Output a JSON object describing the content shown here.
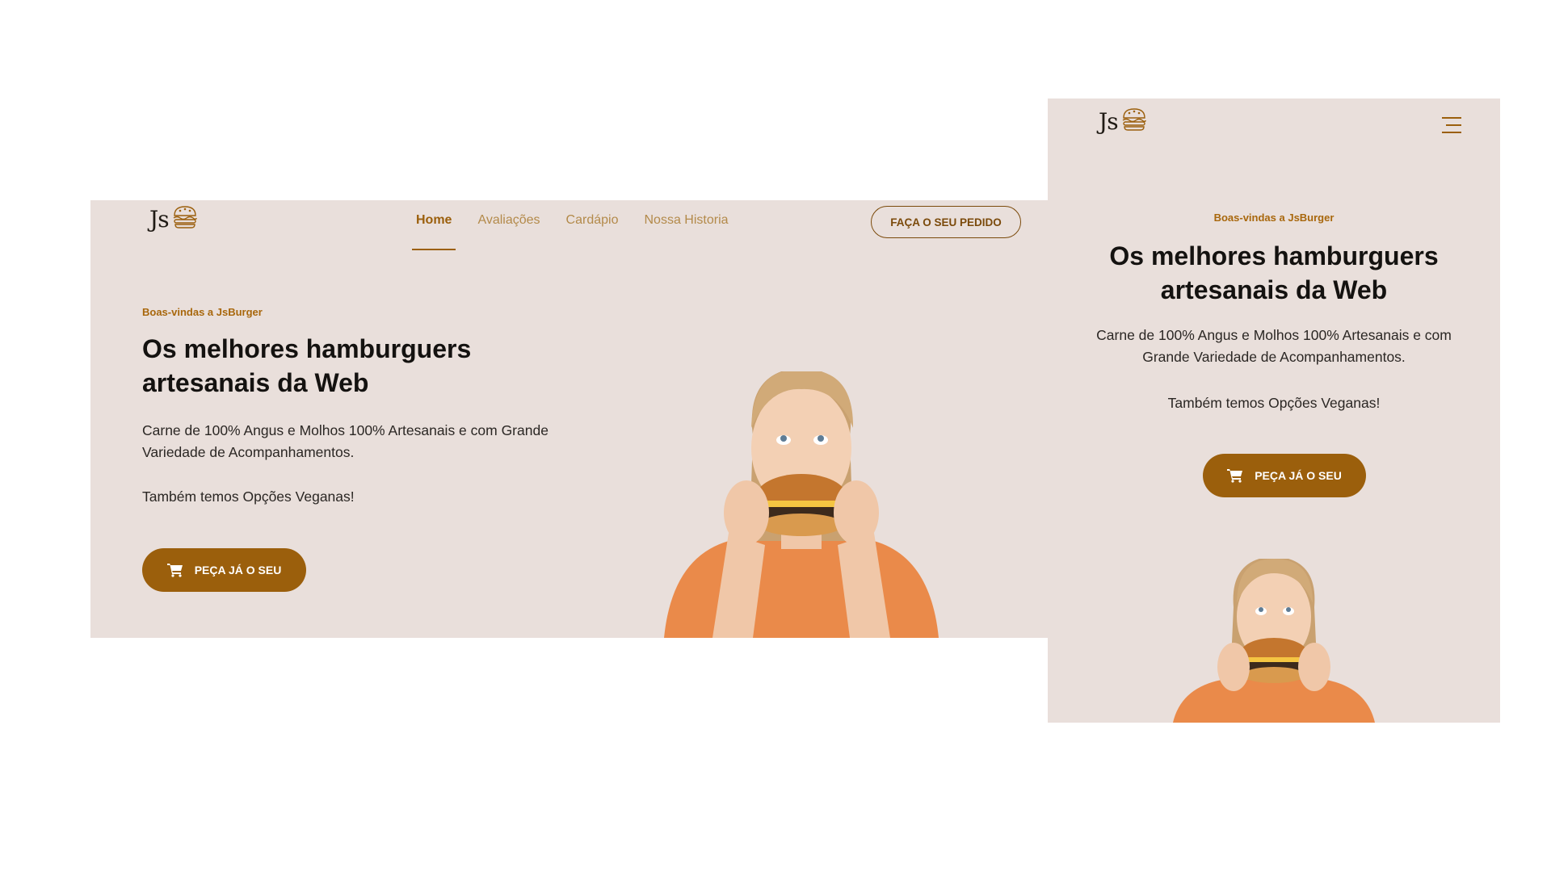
{
  "brand": {
    "logo_text": "Js",
    "logo_icon": "burger-icon"
  },
  "nav": {
    "items": [
      {
        "label": "Home",
        "active": true
      },
      {
        "label": "Avaliações",
        "active": false
      },
      {
        "label": "Cardápio",
        "active": false
      },
      {
        "label": "Nossa Historia",
        "active": false
      }
    ],
    "order_label": "FAÇA O SEU PEDIDO"
  },
  "hero": {
    "welcome": "Boas-vindas a JsBurger",
    "headline": "Os melhores hamburguers artesanais da Web",
    "paragraph1": "Carne de 100% Angus e Molhos 100% Artesanais e com Grande Variedade de Acompanhamentos.",
    "paragraph2": "Também temos Opções Veganas!",
    "cta_label": "PEÇA JÁ O SEU",
    "cta_icon": "cart-icon",
    "image": "woman-eating-burger"
  },
  "colors": {
    "background": "#e9dfdb",
    "accent": "#9b5f0c",
    "nav_inactive": "#b38a4a"
  }
}
